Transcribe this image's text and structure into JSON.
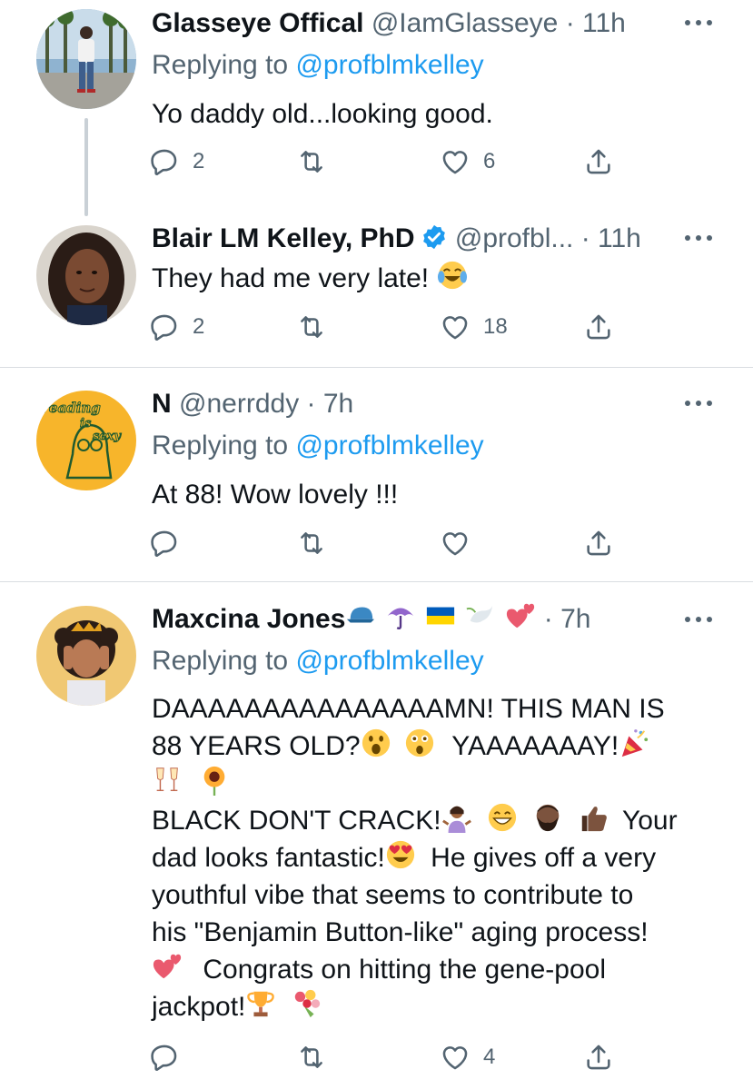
{
  "replying_prefix": "Replying to",
  "tweets": [
    {
      "name": "Glasseye Offical",
      "handle": "@IamGlasseye",
      "time": "· 11h",
      "replying_to": "@profblmkelley",
      "text": "Yo daddy old...looking good.",
      "replies": "2",
      "retweets": "",
      "likes": "6"
    },
    {
      "name": "Blair LM Kelley, PhD",
      "handle": "@profbl...",
      "time": "· 11h",
      "text": "They had me very late!",
      "replies": "2",
      "retweets": "",
      "likes": "18"
    },
    {
      "name": "N",
      "handle": "@nerrddy",
      "time": "· 7h",
      "replying_to": "@profblmkelley",
      "text": "At 88! Wow lovely !!!",
      "replies": "",
      "retweets": "",
      "likes": "",
      "avatar_text": [
        "reading",
        "is",
        "sexy"
      ]
    },
    {
      "name": "Maxcina Jones",
      "handle": "",
      "time": "· 7h",
      "replying_to": "@profblmkelley",
      "text_lines": [
        "DAAAAAAAAAAAAAAAMN! THIS MAN IS",
        "88 YEARS OLD?",
        "YAAAAAAAY!",
        "BLACK DON'T CRACK!",
        "Your",
        "dad looks fantastic!",
        "He gives off a very",
        "youthful vibe that seems to contribute to",
        "his \"Benjamin Button-like\" aging process!",
        "Congrats on hitting the gene-pool",
        "jackpot!"
      ],
      "replies": "",
      "retweets": "",
      "likes": "4"
    }
  ],
  "icons": {
    "reply": "reply-icon",
    "retweet": "retweet-icon",
    "like": "heart-icon",
    "share": "share-icon",
    "more": "more-icon",
    "verified": "verified-badge-icon"
  },
  "colors": {
    "text": "#0f1419",
    "secondary": "#536471",
    "link": "#1d9bf0",
    "divider": "#d9dde1",
    "thread_line": "#c9d0d6"
  }
}
